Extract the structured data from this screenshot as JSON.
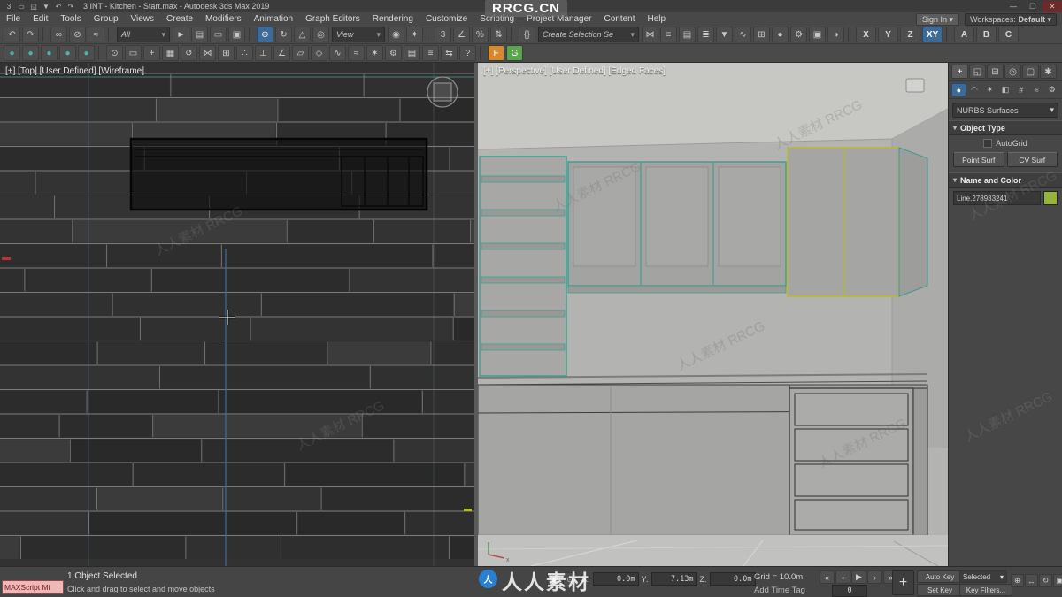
{
  "ui": {
    "caret": "▾",
    "rollout_arrow": "▾",
    "plus": "+"
  },
  "window": {
    "title": "3 INT - Kitchen - Start.max - Autodesk 3ds Max 2019",
    "quick_access": [
      {
        "n": "app-logo-icon",
        "g": "3"
      },
      {
        "n": "new-file-icon",
        "g": "▭"
      },
      {
        "n": "open-file-icon",
        "g": "◱"
      },
      {
        "n": "save-icon",
        "g": "▼"
      },
      {
        "n": "undo-quick-icon",
        "g": "↶"
      },
      {
        "n": "redo-quick-icon",
        "g": "↷"
      }
    ],
    "minimize": "—",
    "maximize": "❐",
    "close": "✕"
  },
  "menu": {
    "items": [
      "File",
      "Edit",
      "Tools",
      "Group",
      "Views",
      "Create",
      "Modifiers",
      "Animation",
      "Graph Editors",
      "Rendering",
      "Customize",
      "Scripting",
      "Project Manager",
      "Content",
      "Help"
    ],
    "sign_in": "Sign In",
    "workspace_label": "Workspaces:",
    "workspace_value": "Default"
  },
  "toolbar1": [
    {
      "t": "i",
      "n": "undo-icon",
      "g": "↶"
    },
    {
      "t": "i",
      "n": "redo-icon",
      "g": "↷"
    },
    {
      "t": "s"
    },
    {
      "t": "i",
      "n": "select-and-link-icon",
      "g": "∞"
    },
    {
      "t": "i",
      "n": "unlink-selection-icon",
      "g": "⊘"
    },
    {
      "t": "i",
      "n": "bind-to-space-warp-icon",
      "g": "≈"
    },
    {
      "t": "s"
    },
    {
      "t": "d",
      "n": "selection-filter-dropdown",
      "g": "All",
      "w": 50
    },
    {
      "t": "i",
      "n": "select-object-icon",
      "g": "►"
    },
    {
      "t": "i",
      "n": "select-by-name-icon",
      "g": "▤"
    },
    {
      "t": "i",
      "n": "rectangular-selection-region-icon",
      "g": "▭"
    },
    {
      "t": "i",
      "n": "window-crossing-toggle-icon",
      "g": "▣"
    },
    {
      "t": "s"
    },
    {
      "t": "i",
      "n": "select-and-move-icon",
      "g": "⊕",
      "a": true
    },
    {
      "t": "i",
      "n": "select-and-rotate-icon",
      "g": "↻"
    },
    {
      "t": "i",
      "n": "select-and-scale-icon",
      "g": "△"
    },
    {
      "t": "i",
      "n": "select-and-place-icon",
      "g": "◎"
    },
    {
      "t": "d",
      "n": "reference-coordinate-dropdown",
      "g": "View",
      "w": 50
    },
    {
      "t": "i",
      "n": "use-pivot-point-icon",
      "g": "◉"
    },
    {
      "t": "i",
      "n": "select-and-manipulate-icon",
      "g": "✦"
    },
    {
      "t": "s"
    },
    {
      "t": "i",
      "n": "snap-toggle-icon",
      "g": "3"
    },
    {
      "t": "i",
      "n": "angle-snap-icon",
      "g": "∠"
    },
    {
      "t": "i",
      "n": "percent-snap-icon",
      "g": "%"
    },
    {
      "t": "i",
      "n": "spinner-snap-icon",
      "g": "⇅"
    },
    {
      "t": "s"
    },
    {
      "t": "i",
      "n": "edit-named-selection-sets-icon",
      "g": "{}"
    },
    {
      "t": "d",
      "n": "named-selection-sets-dropdown",
      "g": "Create Selection Se",
      "w": 104
    },
    {
      "t": "i",
      "n": "mirror-icon",
      "g": "⋈"
    },
    {
      "t": "i",
      "n": "align-icon",
      "g": "≡"
    },
    {
      "t": "i",
      "n": "toggle-scene-explorer-icon",
      "g": "▤"
    },
    {
      "t": "i",
      "n": "toggle-layer-explorer-icon",
      "g": "≣"
    },
    {
      "t": "i",
      "n": "toggle-ribbon-icon",
      "g": "▼"
    },
    {
      "t": "i",
      "n": "curve-editor-icon",
      "g": "∿"
    },
    {
      "t": "i",
      "n": "schematic-view-icon",
      "g": "⊞"
    },
    {
      "t": "i",
      "n": "material-editor-icon",
      "g": "●"
    },
    {
      "t": "i",
      "n": "render-setup-icon",
      "g": "⚙"
    },
    {
      "t": "i",
      "n": "rendered-frame-window-icon",
      "g": "▣"
    },
    {
      "t": "i",
      "n": "render-production-icon",
      "g": "◑"
    },
    {
      "t": "s"
    },
    {
      "t": "l",
      "n": "axis-constraint-x-button",
      "g": "X"
    },
    {
      "t": "l",
      "n": "axis-constraint-y-button",
      "g": "Y"
    },
    {
      "t": "l",
      "n": "axis-constraint-z-button",
      "g": "Z"
    },
    {
      "t": "l",
      "n": "axis-constraint-xy-button",
      "g": "XY",
      "a": true
    },
    {
      "t": "s"
    },
    {
      "t": "l",
      "n": "toolbar-a-button",
      "g": "A"
    },
    {
      "t": "l",
      "n": "toolbar-b-button",
      "g": "B"
    },
    {
      "t": "l",
      "n": "toolbar-c-button",
      "g": "C"
    }
  ],
  "toolbar2": [
    {
      "t": "i",
      "n": "round-tool-icon-1",
      "g": "●",
      "c": "#4fb3a9"
    },
    {
      "t": "i",
      "n": "round-tool-icon-2",
      "g": "●",
      "c": "#4fb3a9"
    },
    {
      "t": "i",
      "n": "round-tool-icon-3",
      "g": "●",
      "c": "#4fb3a9"
    },
    {
      "t": "i",
      "n": "round-tool-icon-4",
      "g": "●",
      "c": "#4fb3a9"
    },
    {
      "t": "i",
      "n": "round-tool-icon-5",
      "g": "●",
      "c": "#4fb3a9"
    },
    {
      "t": "s"
    },
    {
      "t": "i",
      "n": "zoom-region-icon",
      "g": "⊙"
    },
    {
      "t": "i",
      "n": "selection-region-icon",
      "g": "▭"
    },
    {
      "t": "i",
      "n": "axis-gizmo-icon",
      "g": "+"
    },
    {
      "t": "i",
      "n": "grid-snap-icon",
      "g": "▦"
    },
    {
      "t": "i",
      "n": "rotate-gizmo-icon",
      "g": "↺"
    },
    {
      "t": "i",
      "n": "mirror-tool-icon",
      "g": "⋈"
    },
    {
      "t": "i",
      "n": "array-tool-icon",
      "g": "⊞"
    },
    {
      "t": "i",
      "n": "spacing-tool-icon",
      "g": "∴"
    },
    {
      "t": "i",
      "n": "normal-align-icon",
      "g": "⊥"
    },
    {
      "t": "i",
      "n": "angle-measure-icon",
      "g": "∠"
    },
    {
      "t": "i",
      "n": "uvw-map-icon",
      "g": "▱"
    },
    {
      "t": "i",
      "n": "shape-tool-icon",
      "g": "◇"
    },
    {
      "t": "i",
      "n": "curve-tool-icon",
      "g": "∿"
    },
    {
      "t": "i",
      "n": "wave-modifier-icon",
      "g": "≈"
    },
    {
      "t": "i",
      "n": "light-tool-icon",
      "g": "✶"
    },
    {
      "t": "i",
      "n": "settings-tool-icon",
      "g": "⚙"
    },
    {
      "t": "i",
      "n": "list-tool-icon",
      "g": "▤"
    },
    {
      "t": "i",
      "n": "align-tool-icon",
      "g": "≡"
    },
    {
      "t": "i",
      "n": "swap-tool-icon",
      "g": "⇆"
    },
    {
      "t": "i",
      "n": "help-tool-icon",
      "g": "?"
    },
    {
      "t": "s"
    },
    {
      "t": "i",
      "n": "forest-pack-icon",
      "g": "F",
      "c": "#fff",
      "bg": "#d9882b"
    },
    {
      "t": "i",
      "n": "railclone-icon",
      "g": "G",
      "c": "#fff",
      "bg": "#58a54a"
    }
  ],
  "viewports": {
    "left_label": "[+] [Top] [User Defined] [Wireframe]",
    "right_label": "[+] [Perspective] [User Defined] [Edged Faces]"
  },
  "command_panel": {
    "tabs": [
      {
        "n": "create-tab",
        "g": "+",
        "a": true
      },
      {
        "n": "modify-tab",
        "g": "◱"
      },
      {
        "n": "hierarchy-tab",
        "g": "⊟"
      },
      {
        "n": "motion-tab",
        "g": "◎"
      },
      {
        "n": "display-tab",
        "g": "▢"
      },
      {
        "n": "utilities-tab",
        "g": "✱"
      }
    ],
    "categories": [
      {
        "n": "geometry-category",
        "g": "●",
        "a": true
      },
      {
        "n": "shapes-category",
        "g": "◠"
      },
      {
        "n": "lights-category",
        "g": "✶"
      },
      {
        "n": "cameras-category",
        "g": "◧"
      },
      {
        "n": "helpers-category",
        "g": "#"
      },
      {
        "n": "space-warps-category",
        "g": "≈"
      },
      {
        "n": "systems-category",
        "g": "⚙"
      }
    ],
    "subcategory": "NURBS Surfaces",
    "object_type": {
      "title": "Object Type",
      "autogrid_label": "AutoGrid",
      "buttons": [
        "Point Surf",
        "CV Surf"
      ]
    },
    "name_color": {
      "title": "Name and Color",
      "name": "Line.278933241",
      "color": "#97b43a"
    }
  },
  "status": {
    "maxscript_label": "MAXScript Mi",
    "selection": "1 Object Selected",
    "prompt": "Click and drag to select and move objects",
    "small_icons": [
      {
        "n": "isolate-selection-icon",
        "g": "▣"
      },
      {
        "n": "selection-lock-icon",
        "g": "⊙"
      }
    ],
    "coord_labels": [
      "X:",
      "Y:",
      "Z:"
    ],
    "coord_values": [
      "0.0m",
      "7.13m",
      "0.0m"
    ],
    "grid": "Grid = 10.0m",
    "add_time_tag": "Add Time Tag",
    "frame": "0",
    "transport": [
      {
        "n": "go-to-start-button",
        "g": "«"
      },
      {
        "n": "previous-frame-button",
        "g": "‹"
      },
      {
        "n": "play-button",
        "g": "▶"
      },
      {
        "n": "next-frame-button",
        "g": "›"
      },
      {
        "n": "go-to-end-button",
        "g": "»"
      }
    ],
    "auto_key": "Auto Key",
    "key_mode": "Selected",
    "set_key": "Set Key",
    "key_filters": "Key Filters...",
    "nav": [
      {
        "n": "zoom-icon",
        "g": "⊕"
      },
      {
        "n": "pan-icon",
        "g": "↔"
      },
      {
        "n": "orbit-icon",
        "g": "↻"
      },
      {
        "n": "maximize-viewport-toggle-icon",
        "g": "▣"
      }
    ]
  },
  "watermarks": {
    "top": "RRCG.CN",
    "bottom": "人人素材",
    "logo": "人",
    "diagonal": "人人素材 RRCG"
  }
}
